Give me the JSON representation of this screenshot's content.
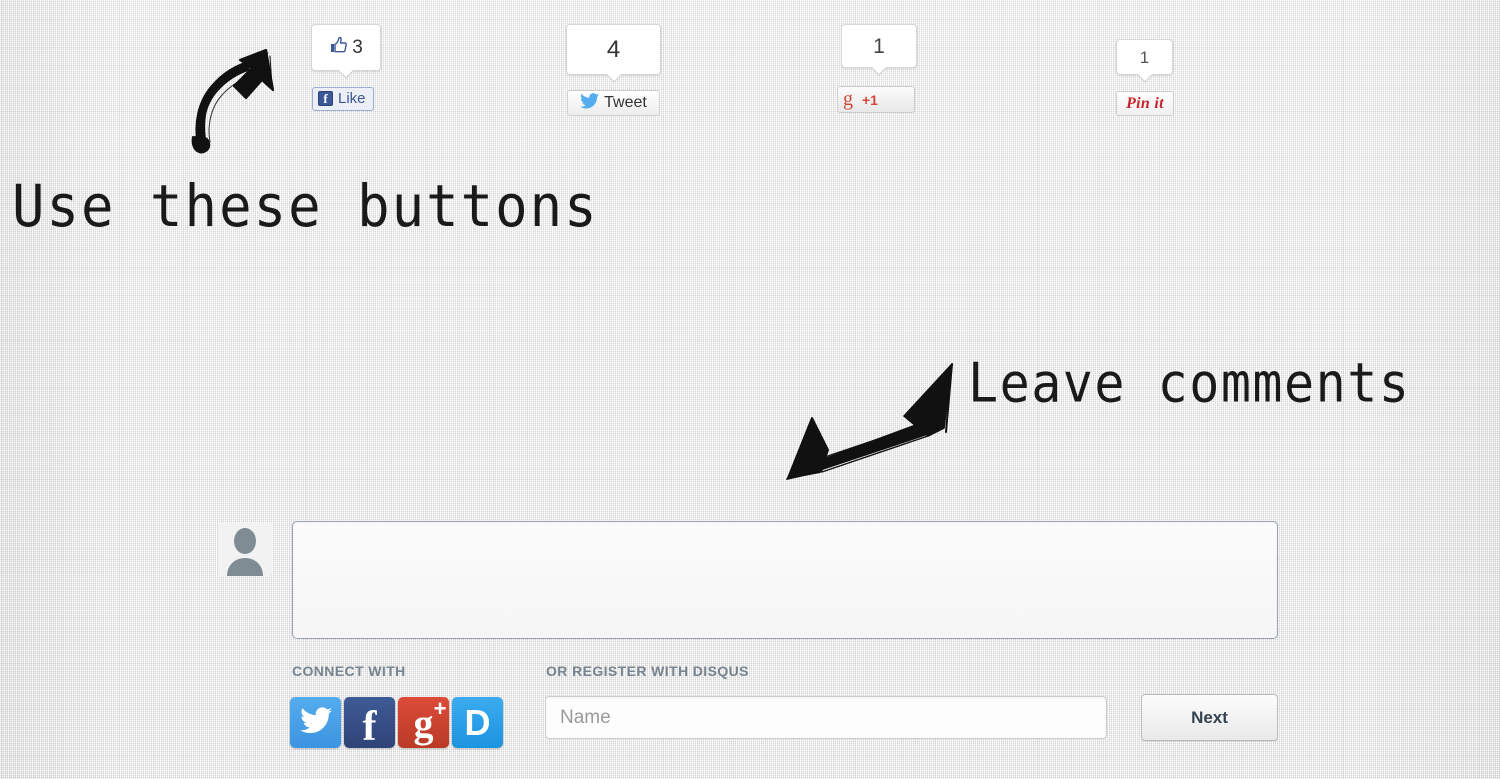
{
  "share_bar": {
    "facebook": {
      "count": "3",
      "button_label": "Like",
      "logo_letter": "f",
      "icon": "thumbs-up-icon"
    },
    "twitter": {
      "count": "4",
      "button_label": "Tweet",
      "icon": "twitter-bird-icon"
    },
    "google_plus": {
      "count": "1",
      "button_label": "+1",
      "logo_letter": "g",
      "icon": "google-g-icon"
    },
    "pinterest": {
      "count": "1",
      "button_label": "Pin it",
      "icon": "pinterest-icon"
    }
  },
  "annotations": {
    "use_buttons": "Use these buttons",
    "leave_comments": "Leave comments",
    "arrow_up_right": "sketch-arrow-up-right-icon",
    "arrow_down_left": "sketch-arrow-down-left-icon"
  },
  "comment_form": {
    "avatar_alt": "default-avatar-icon",
    "textarea_value": "",
    "textarea_placeholder": "",
    "connect_label": "CONNECT WITH",
    "register_label": "OR REGISTER WITH DISQUS",
    "social_logins": [
      {
        "name": "Twitter",
        "glyph": "twitter-bird-icon",
        "color": "#55acee"
      },
      {
        "name": "Facebook",
        "glyph": "f",
        "color": "#3f5b96"
      },
      {
        "name": "Google+",
        "glyph": "g",
        "color": "#dd4b39"
      },
      {
        "name": "Disqus",
        "glyph": "D",
        "color": "#2e9fff"
      }
    ],
    "name_field": {
      "value": "",
      "placeholder": "Name"
    },
    "next_button_label": "Next"
  },
  "colors": {
    "facebook_blue": "#3b5998",
    "twitter_blue": "#55acee",
    "google_red": "#dd4b39",
    "pinterest_red": "#c8232c",
    "disqus_blue": "#2e9fff",
    "label_grey": "#77838f",
    "page_bg": "#e8e8e8"
  }
}
